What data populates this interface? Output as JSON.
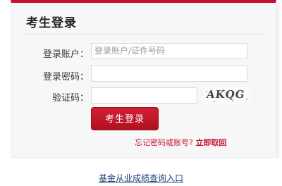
{
  "login_panel": {
    "title": "考生登录",
    "account_label": "登录账户",
    "account_placeholder": "登录账户/证件号码",
    "password_label": "登录密码",
    "captcha_label": "验证码",
    "colon": "：",
    "captcha_text": "AKQG",
    "login_button": "考生登录",
    "forgot_prefix": "忘记密码或账号?",
    "forgot_link": "立即取回"
  },
  "footer": {
    "query_link": "基金从业成绩查询入口"
  },
  "colors": {
    "accent": "#c8102e",
    "link": "#1a3f7a",
    "panel_bg": "#f7f7f7"
  }
}
